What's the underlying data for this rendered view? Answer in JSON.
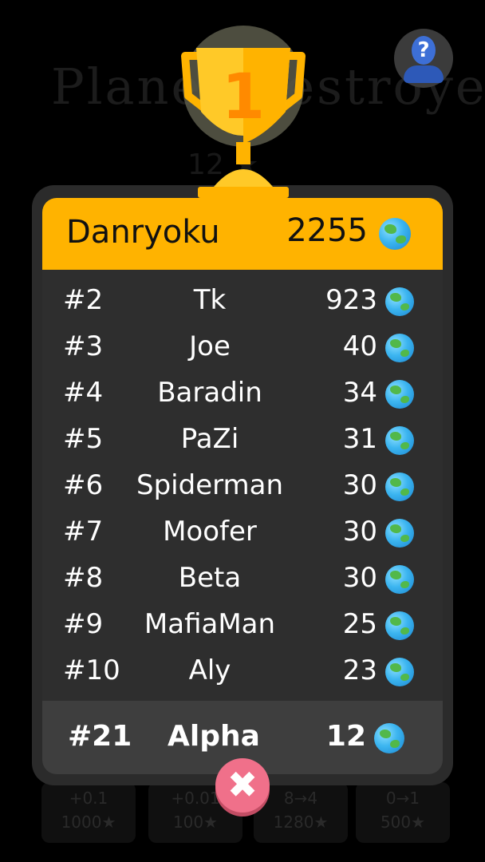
{
  "background": {
    "title": "Planet Destroyer",
    "stars": "12 ★",
    "cards": [
      {
        "line1": "+0.1",
        "line2": "1000★"
      },
      {
        "line1": "+0.01",
        "line2": "100★"
      },
      {
        "line1": "8→4",
        "line2": "1280★"
      },
      {
        "line1": "0→1",
        "line2": "500★"
      }
    ]
  },
  "help_button": {
    "glyph": "?"
  },
  "trophy": {
    "rank_label": "1"
  },
  "leaderboard": {
    "top": {
      "name": "Danryoku",
      "score": "2255"
    },
    "rows": [
      {
        "rank": "#2",
        "name": "Tk",
        "score": "923"
      },
      {
        "rank": "#3",
        "name": "Joe",
        "score": "40"
      },
      {
        "rank": "#4",
        "name": "Baradin",
        "score": "34"
      },
      {
        "rank": "#5",
        "name": "PaZi",
        "score": "31"
      },
      {
        "rank": "#6",
        "name": "Spiderman",
        "score": "30"
      },
      {
        "rank": "#7",
        "name": "Moofer",
        "score": "30"
      },
      {
        "rank": "#8",
        "name": "Beta",
        "score": "30"
      },
      {
        "rank": "#9",
        "name": "MafiaMan",
        "score": "25"
      },
      {
        "rank": "#10",
        "name": "Aly",
        "score": "23"
      }
    ],
    "me": {
      "rank": "#21",
      "name": "Alpha",
      "score": "12"
    }
  },
  "close_button": {
    "glyph": "✖"
  },
  "colors": {
    "accent": "#ffb300",
    "panel": "#2b2b2b",
    "close": "#f0708a"
  },
  "icons": {
    "score": "earth-globe-icon",
    "trophy": "trophy-icon",
    "help": "help-avatar-icon",
    "close": "close-icon"
  }
}
